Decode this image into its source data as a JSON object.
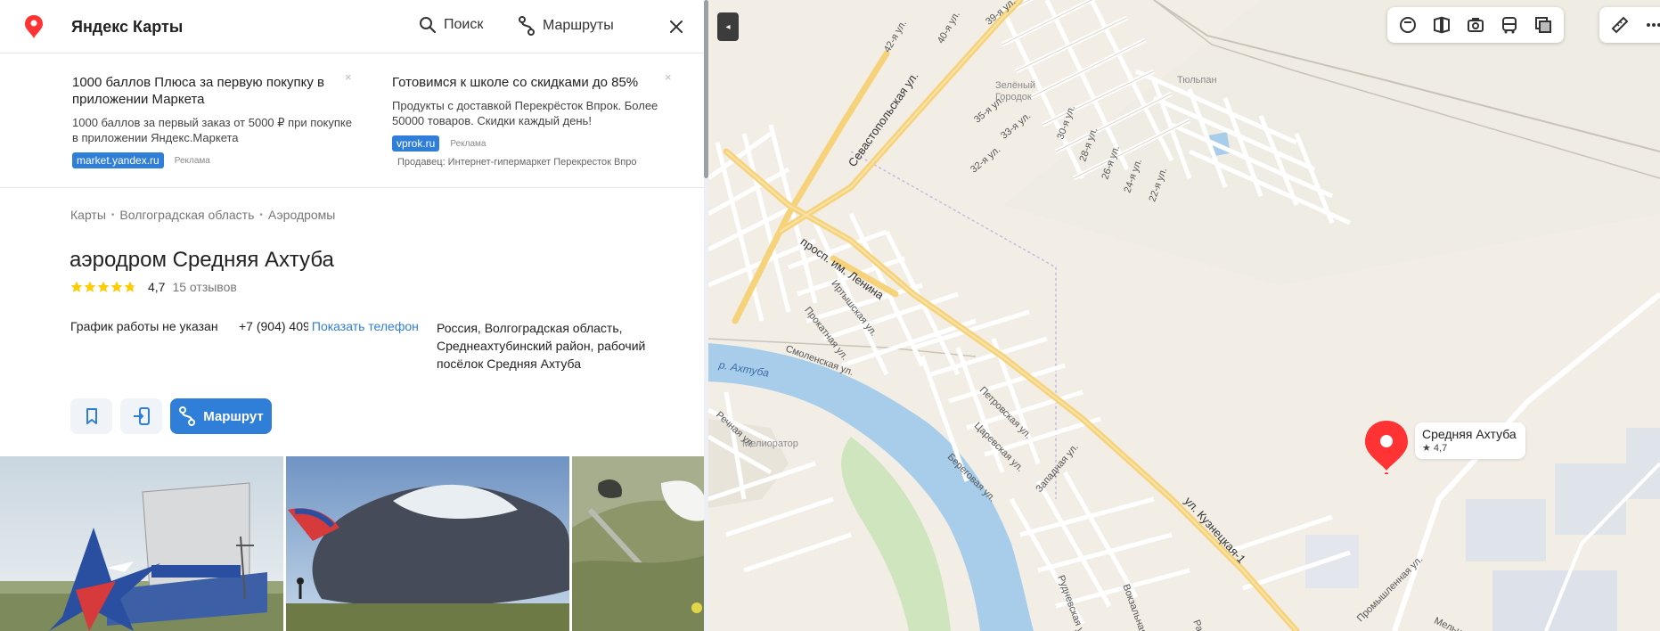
{
  "header": {
    "logo_text": "Яндекс Карты",
    "search_label": "Поиск",
    "routes_label": "Маршруты"
  },
  "ads": [
    {
      "title": "1000 баллов Плюса за первую покупку в приложении Маркета",
      "text": "1000 баллов за первый заказ от 5000 ₽ при покупке в приложении Яндекс.Маркета",
      "domain": "market.yandex.ru",
      "mark": "Реклама",
      "seller": ""
    },
    {
      "title": "Готовимся к школе со скидками до 85%",
      "text": "Продукты с доставкой Перекрёсток Впрок. Более 50000 товаров. Скидки каждый день!",
      "domain": "vprok.ru",
      "mark": "Реклама",
      "seller": "Продавец:  Интернет-гипермаркет Перекресток Впро"
    }
  ],
  "ad_close_glyph": "×",
  "breadcrumbs": [
    "Карты",
    "Волгоградская область",
    "Аэродромы"
  ],
  "place": {
    "title": "аэродром Средняя Ахтуба",
    "rating": "4,7",
    "rating_fraction": 0.94,
    "reviews": "15 отзывов",
    "hours": "График работы не указан",
    "phone": "+7 (904) 409",
    "show_phone": "Показать телефон",
    "address": "Россия, Волгоградская область, Среднеахтубинский район, рабочий посёлок Средняя Ахтуба",
    "route_label": "Маршрут"
  },
  "map": {
    "labels": {
      "sevastopolskaya": "Севастопольская ул.",
      "lenina": "просп. им. Ленина",
      "kuznetskaya": "ул. Кузнецкая-1",
      "akhtuba": "р. Ахтуба",
      "zeleny": "Зелёный",
      "gorodok": "Городок",
      "tyulpan": "Тюльпан",
      "melior": "Мелиоратор",
      "irtyshskaya": "Иртышская ул.",
      "prokatnaya": "Прокатная ул.",
      "smolenskaya": "Смоленская ул.",
      "rechnaya": "Речная ул.",
      "petrovskaya": "Петровская ул.",
      "tsarevskaya": "Царевская ул.",
      "beregovaya": "Береговая ул.",
      "zapadnaya": "Западная ул.",
      "rudnevskaya": "Рудневская ул.",
      "vokzalnaya": "Вокзальная ул.",
      "rabochaya": "Рабоч",
      "promyshlennaya": "Промышленная ул.",
      "melnich": "Мельн",
      "s42": "42-я ул.",
      "s40": "40-я ул.",
      "s39": "39-я ул.",
      "s35": "35-я ул.",
      "s33": "33-я ул.",
      "s32": "32-я ул.",
      "s30": "30-я ул.",
      "s28": "28-я ул.",
      "s26": "26-я ул.",
      "s24": "24-я ул.",
      "s22": "22-я ул."
    },
    "pin": {
      "name": "Средняя Ахтуба",
      "rating": "★ 4,7"
    },
    "collapse_glyph": "◂"
  },
  "colors": {
    "accent": "#2f7ed8",
    "pin": "#f33",
    "star": "#fc0",
    "road_major": "#f6d27a",
    "water": "#a8cdea",
    "greenery": "#cfe5bd"
  }
}
